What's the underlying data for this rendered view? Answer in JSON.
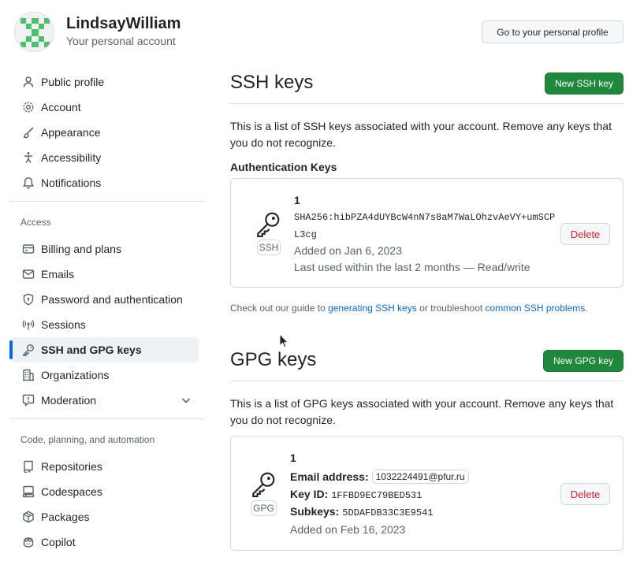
{
  "account": {
    "name": "LindsayWilliam",
    "subtitle": "Your personal account",
    "profile_button": "Go to your personal profile"
  },
  "sidebar": {
    "items_top": [
      {
        "label": "Public profile",
        "icon": "person-icon"
      },
      {
        "label": "Account",
        "icon": "gear-icon"
      },
      {
        "label": "Appearance",
        "icon": "paintbrush-icon"
      },
      {
        "label": "Accessibility",
        "icon": "accessibility-icon"
      },
      {
        "label": "Notifications",
        "icon": "bell-icon"
      }
    ],
    "access_title": "Access",
    "items_access": [
      {
        "label": "Billing and plans",
        "icon": "credit-card-icon"
      },
      {
        "label": "Emails",
        "icon": "mail-icon"
      },
      {
        "label": "Password and authentication",
        "icon": "shield-lock-icon"
      },
      {
        "label": "Sessions",
        "icon": "broadcast-icon"
      },
      {
        "label": "SSH and GPG keys",
        "icon": "key-icon",
        "selected": true
      },
      {
        "label": "Organizations",
        "icon": "organization-icon"
      },
      {
        "label": "Moderation",
        "icon": "report-icon"
      }
    ],
    "code_title": "Code, planning, and automation",
    "items_code": [
      {
        "label": "Repositories",
        "icon": "repo-icon"
      },
      {
        "label": "Codespaces",
        "icon": "codespaces-icon"
      },
      {
        "label": "Packages",
        "icon": "package-icon"
      },
      {
        "label": "Copilot",
        "icon": "copilot-icon"
      }
    ]
  },
  "ssh": {
    "title": "SSH keys",
    "new_button": "New SSH key",
    "description": "This is a list of SSH keys associated with your account. Remove any keys that you do not recognize.",
    "section_title": "Authentication Keys",
    "key": {
      "name": "1",
      "fingerprint_line1": "SHA256:hibPZA4dUYBcW4nN7s8aM7WaLOhzvAeVY+umSCP",
      "fingerprint_line2": "L3cg",
      "added": "Added on Jan 6, 2023",
      "last_used": "Last used within the last 2 months — Read/write",
      "tag": "SSH",
      "delete": "Delete"
    },
    "guide_prefix": "Check out our guide to ",
    "guide_link1": "generating SSH keys",
    "guide_middle": " or troubleshoot ",
    "guide_link2": "common SSH problems",
    "guide_suffix": "."
  },
  "gpg": {
    "title": "GPG keys",
    "new_button": "New GPG key",
    "description": "This is a list of GPG keys associated with your account. Remove any keys that you do not recognize.",
    "key": {
      "name": "1",
      "email_label": "Email address:",
      "email": "1032224491@pfur.ru",
      "keyid_label": "Key ID:",
      "keyid": "1FFBD9EC79BED531",
      "subkeys_label": "Subkeys:",
      "subkeys": "5DDAFDB33C3E9541",
      "added": "Added on Feb 16, 2023",
      "tag": "GPG",
      "delete": "Delete"
    }
  },
  "colors": {
    "accent": "#0969da",
    "primary_button": "#1f883d",
    "danger": "#d1242f",
    "avatar": "#4cc06a"
  }
}
